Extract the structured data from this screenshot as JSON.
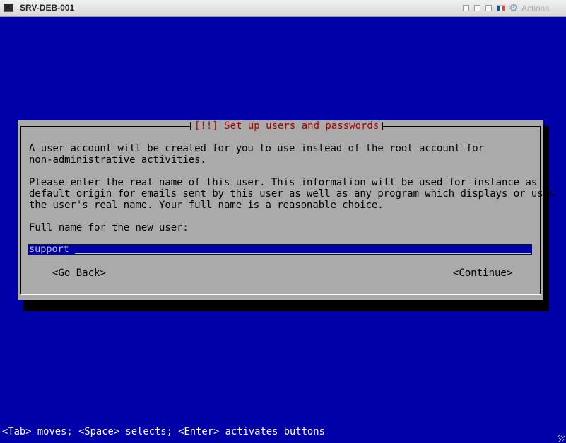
{
  "window": {
    "title": "SRV-DEB-001",
    "actions_label": "Actions",
    "icons": [
      "terminal-icon",
      "window-restore-icon",
      "window-minimize-icon",
      "window-maximize-icon",
      "language-flag-icon",
      "gear-icon"
    ],
    "flag_colors": [
      "#0055a4",
      "#ffffff",
      "#ef4135"
    ]
  },
  "dialog": {
    "title": "[!!] Set up users and passwords",
    "paragraph1": "A user account will be created for you to use instead of the root account for\nnon-administrative activities.",
    "paragraph2": "Please enter the real name of this user. This information will be used for instance as\ndefault origin for emails sent by this user as well as any program which displays or uses\nthe user's real name. Your full name is a reasonable choice.",
    "field_label": "Full name for the new user:",
    "field_value": "support",
    "go_back_label": "<Go Back>",
    "continue_label": "<Continue>"
  },
  "footer_hint": "<Tab> moves; <Space> selects; <Enter> activates buttons",
  "colors": {
    "background": "#0000a8",
    "dialog": "#aaaaaa",
    "title_text": "#a80000",
    "field": "#0000a8"
  }
}
